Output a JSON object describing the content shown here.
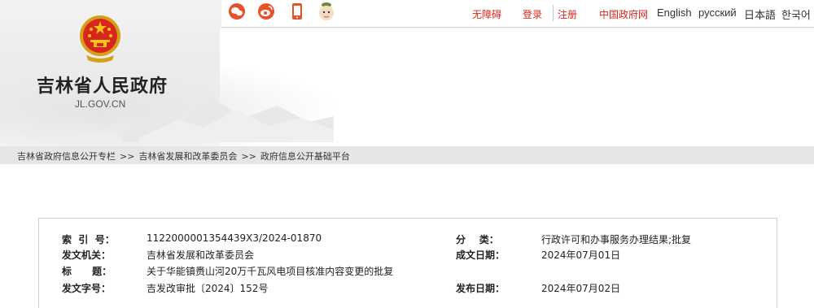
{
  "header": {
    "site_title": "吉林省人民政府",
    "site_domain": "JL.GOV.CN"
  },
  "topbar": {
    "social_icons": [
      "wechat-icon",
      "weibo-icon",
      "mobile-icon",
      "mascot-icon"
    ],
    "accessibility": "无障碍",
    "login": "登录",
    "register": "注册",
    "gov_portal": "中国政府网",
    "lang_en": "English",
    "lang_ru": "русский",
    "lang_jp": "日本語",
    "lang_kr": "한국어"
  },
  "breadcrumb": {
    "items": [
      "吉林省政府信息公开专栏",
      "吉林省发展和改革委员会",
      "政府信息公开基础平台"
    ],
    "separator": ">>"
  },
  "doc_info": {
    "index_label": "索  引  号：",
    "index_value": "1122000001354439X3/2024-01870",
    "category_label": "分    类：",
    "category_value": "行政许可和办事服务办理结果;批复",
    "issuer_label": "发文机关：",
    "issuer_value": "吉林省发展和改革委员会",
    "written_date_label": "成文日期：",
    "written_date_value": "2024年07月01日",
    "title_label": "标      题：",
    "title_value": "关于华能镇赉山河20万千瓦风电项目核准内容变更的批复",
    "doc_number_label": "发文字号：",
    "doc_number_value": "吉发改审批〔2024〕152号",
    "publish_date_label": "发布日期：",
    "publish_date_value": "2024年07月02日"
  },
  "colors": {
    "accent_red": "#d9261c",
    "crumb_bg": "#e6e6e6"
  }
}
